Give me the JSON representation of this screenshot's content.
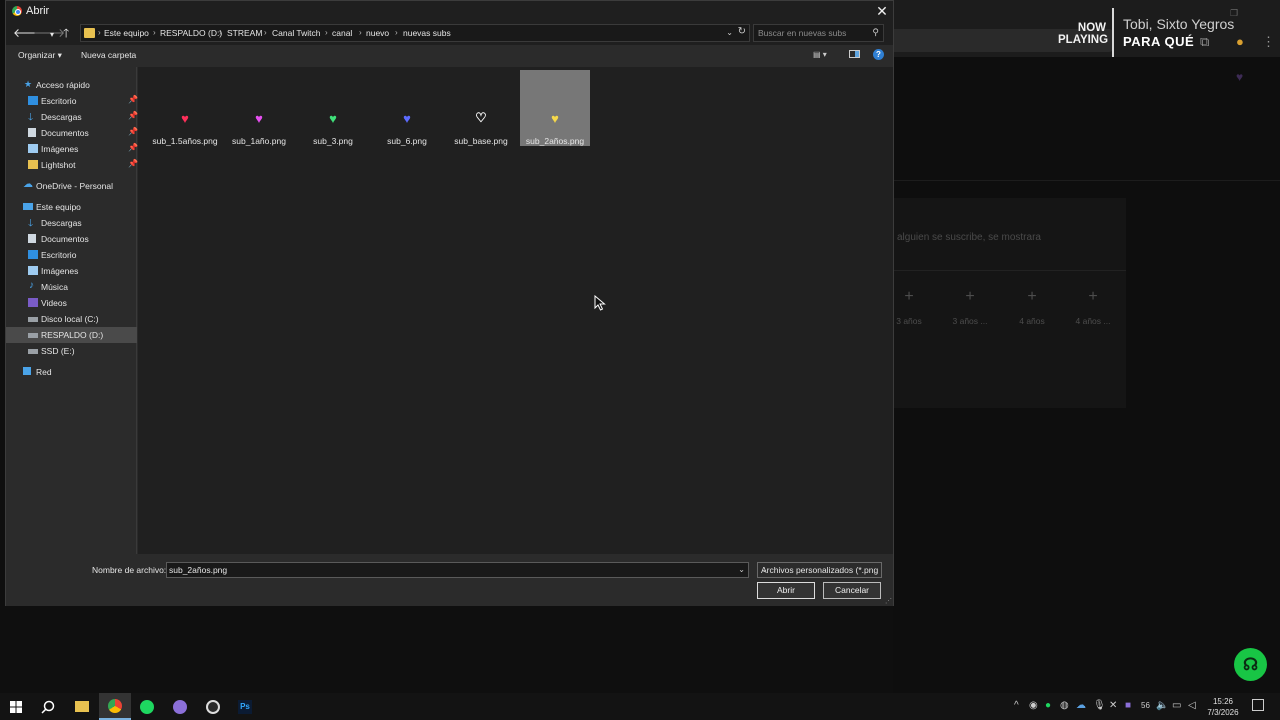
{
  "background": {
    "now_playing_label": "NOW\nPLAYING",
    "now_playing_artist": "Tobi, Sixto Yegros",
    "now_playing_song": "PARA QUÉ",
    "subscribe_hint": "alguien se suscribe, se mostrara",
    "slots": [
      {
        "label": "3 años"
      },
      {
        "label": "3 años ..."
      },
      {
        "label": "4 años"
      },
      {
        "label": "4 años ..."
      }
    ]
  },
  "dialog": {
    "title": "Abrir",
    "breadcrumb": [
      "Este equipo",
      "RESPALDO (D:)",
      "STREAM",
      "Canal Twitch",
      "canal",
      "nuevo",
      "nuevas subs"
    ],
    "search_placeholder": "Buscar en nuevas subs",
    "toolbar": {
      "organize": "Organizar ▾",
      "new_folder": "Nueva carpeta",
      "help": "?"
    },
    "sidebar": {
      "quick_access": "Acceso rápido",
      "quick_items": [
        "Escritorio",
        "Descargas",
        "Documentos",
        "Imágenes",
        "Lightshot"
      ],
      "onedrive": "OneDrive - Personal",
      "this_pc": "Este equipo",
      "pc_items": [
        "Descargas",
        "Documentos",
        "Escritorio",
        "Imágenes",
        "Música",
        "Videos",
        "Disco local (C:)",
        "RESPALDO (D:)",
        "SSD (E:)"
      ],
      "network": "Red"
    },
    "files": [
      {
        "name": "sub_1.5años.png",
        "color": "#ff2f5a"
      },
      {
        "name": "sub_1año.png",
        "color": "#e64ff0"
      },
      {
        "name": "sub_3.png",
        "color": "#3fe07a"
      },
      {
        "name": "sub_6.png",
        "color": "#5c6bff"
      },
      {
        "name": "sub_base.png",
        "color": "#ffffff"
      },
      {
        "name": "sub_2años.png",
        "color": "#f5d84a"
      }
    ],
    "filename_label": "Nombre de archivo:",
    "filename_value": "sub_2años.png",
    "filter": "Archivos personalizados (*.png",
    "open_button": "Abrir",
    "cancel_button": "Cancelar"
  },
  "taskbar": {
    "clock_time": "15:26",
    "clock_date": "7/3/2026",
    "tray_number": "56"
  }
}
